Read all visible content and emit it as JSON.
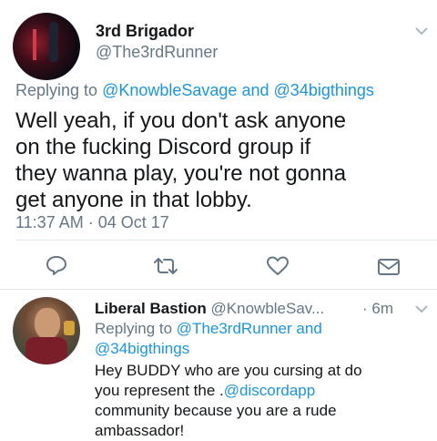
{
  "tweet": {
    "display_name": "3rd Brigador",
    "handle": "@The3rdRunner",
    "replying_prefix": "Replying to",
    "replying_user1": "@KnowbleSavage",
    "replying_and": "and",
    "replying_user2": "@34bigthings",
    "text_lines": [
      "Well yeah, if you don't ask anyone",
      "on the fucking Discord group if",
      "they wanna play, you're not gonna",
      "get anyone in that lobby."
    ],
    "timestamp": "11:37 AM · 04 Oct 17"
  },
  "reply": {
    "display_name": "Liberal Bastion",
    "handle": "@KnowbleSav...",
    "time": "· 6m",
    "replying_prefix": "Replying to",
    "replying_user1": "@The3rdRunner",
    "replying_and": "and",
    "replying_user2": "@34bigthings",
    "text_line1": "Hey BUDDY who are you cursing at do",
    "text_line2_pre": "you represent the .",
    "text_line2_link": "@discordapp",
    "text_line3": "community because you are a rude",
    "text_line4": "ambassador!"
  },
  "colors": {
    "link": "#1b95e0",
    "secondary": "#657786",
    "divider": "#e1e8ed"
  },
  "icons": [
    "chevron-down-icon",
    "reply-icon",
    "retweet-icon",
    "like-icon",
    "direct-message-icon"
  ]
}
